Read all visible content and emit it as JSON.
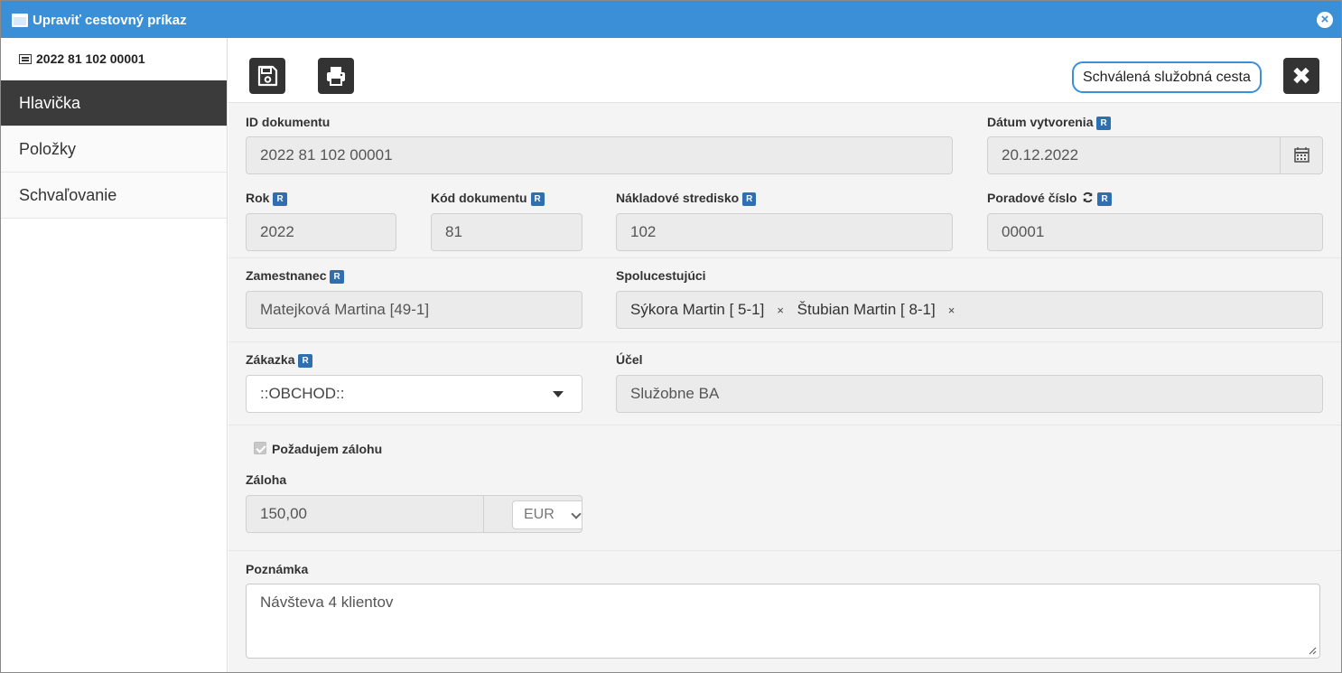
{
  "window": {
    "title": "Upraviť cestovný príkaz"
  },
  "sidebar": {
    "doc_id": "2022 81 102 00001",
    "items": [
      {
        "label": "Hlavička",
        "active": true
      },
      {
        "label": "Položky",
        "active": false
      },
      {
        "label": "Schvaľovanie",
        "active": false
      }
    ]
  },
  "toolbar": {
    "save_icon": "floppy-disk-icon",
    "print_icon": "printer-icon",
    "status": "Schválená služobná cesta",
    "close_icon": "close-icon"
  },
  "badge_label": "R",
  "form": {
    "id_dokumentu": {
      "label": "ID dokumentu",
      "value": "2022 81 102 00001"
    },
    "datum_vytvorenia": {
      "label": "Dátum vytvorenia",
      "value": "20.12.2022"
    },
    "rok": {
      "label": "Rok",
      "value": "2022"
    },
    "kod_dokumentu": {
      "label": "Kód dokumentu",
      "value": "81"
    },
    "nakladove_stredisko": {
      "label": "Nákladové stredisko",
      "value": "102"
    },
    "poradove_cislo": {
      "label": "Poradové číslo",
      "value": "00001"
    },
    "zamestnanec": {
      "label": "Zamestnanec",
      "value": "Matejková Martina [49-1]"
    },
    "spolucestujuci": {
      "label": "Spolucestujúci",
      "tags": [
        "Sýkora Martin [ 5-1]",
        "Štubian Martin [ 8-1]"
      ],
      "remove_glyph": "×"
    },
    "zakazka": {
      "label": "Zákazka",
      "value": "::OBCHOD::"
    },
    "ucel": {
      "label": "Účel",
      "value": "Služobne BA"
    },
    "pozadujem_zalohu": {
      "label": "Požadujem zálohu",
      "checked": true
    },
    "zaloha": {
      "label": "Záloha",
      "value": "150,00",
      "currency": "EUR"
    },
    "poznamka": {
      "label": "Poznámka",
      "value": "Návšteva 4 klientov"
    }
  },
  "colors": {
    "titlebar": "#3a8fd6",
    "badge": "#2f6fb1",
    "active_nav": "#3b3b3b",
    "button_dark": "#333333"
  }
}
